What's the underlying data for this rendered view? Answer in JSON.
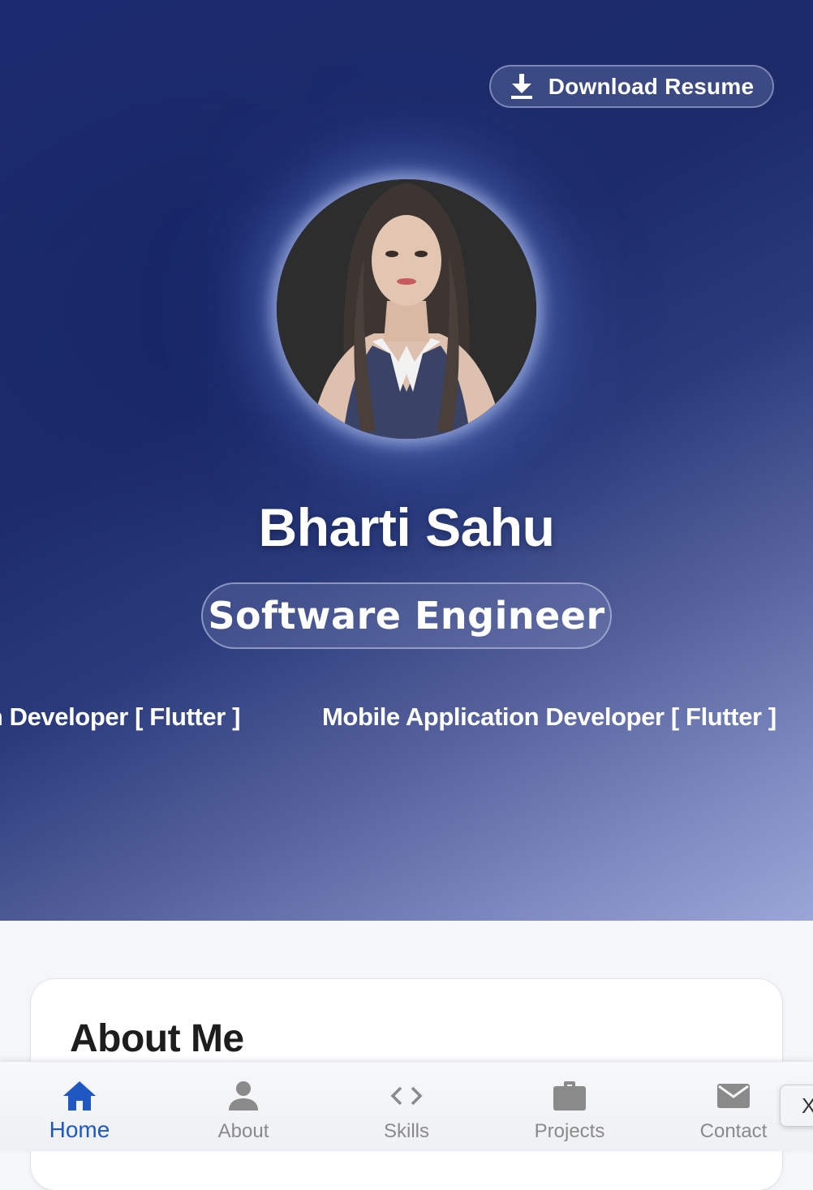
{
  "hero": {
    "download_button": {
      "label": "Download Resume",
      "icon": "download-icon"
    },
    "profile": {
      "avatar_alt": "profile-photo",
      "name": "Bharti Sahu",
      "role": "Software Engineer"
    },
    "marquee": {
      "items": [
        "n Developer [ Flutter ]",
        "Mobile Application Developer [ Flutter ]"
      ]
    },
    "colors": {
      "gradient_dark": "#1b2a6e",
      "gradient_light": "#9aa6d6"
    }
  },
  "about": {
    "title": "About Me"
  },
  "bottom_nav": {
    "items": [
      {
        "label": "Home",
        "icon": "home-icon",
        "active": true
      },
      {
        "label": "About",
        "icon": "person-icon",
        "active": false
      },
      {
        "label": "Skills",
        "icon": "code-icon",
        "active": false
      },
      {
        "label": "Projects",
        "icon": "briefcase-icon",
        "active": false
      },
      {
        "label": "Contact",
        "icon": "mail-icon",
        "active": false
      }
    ],
    "active_color": "#1f57c3",
    "inactive_color": "#8a8a8a"
  },
  "close_chip": {
    "label": "X"
  }
}
